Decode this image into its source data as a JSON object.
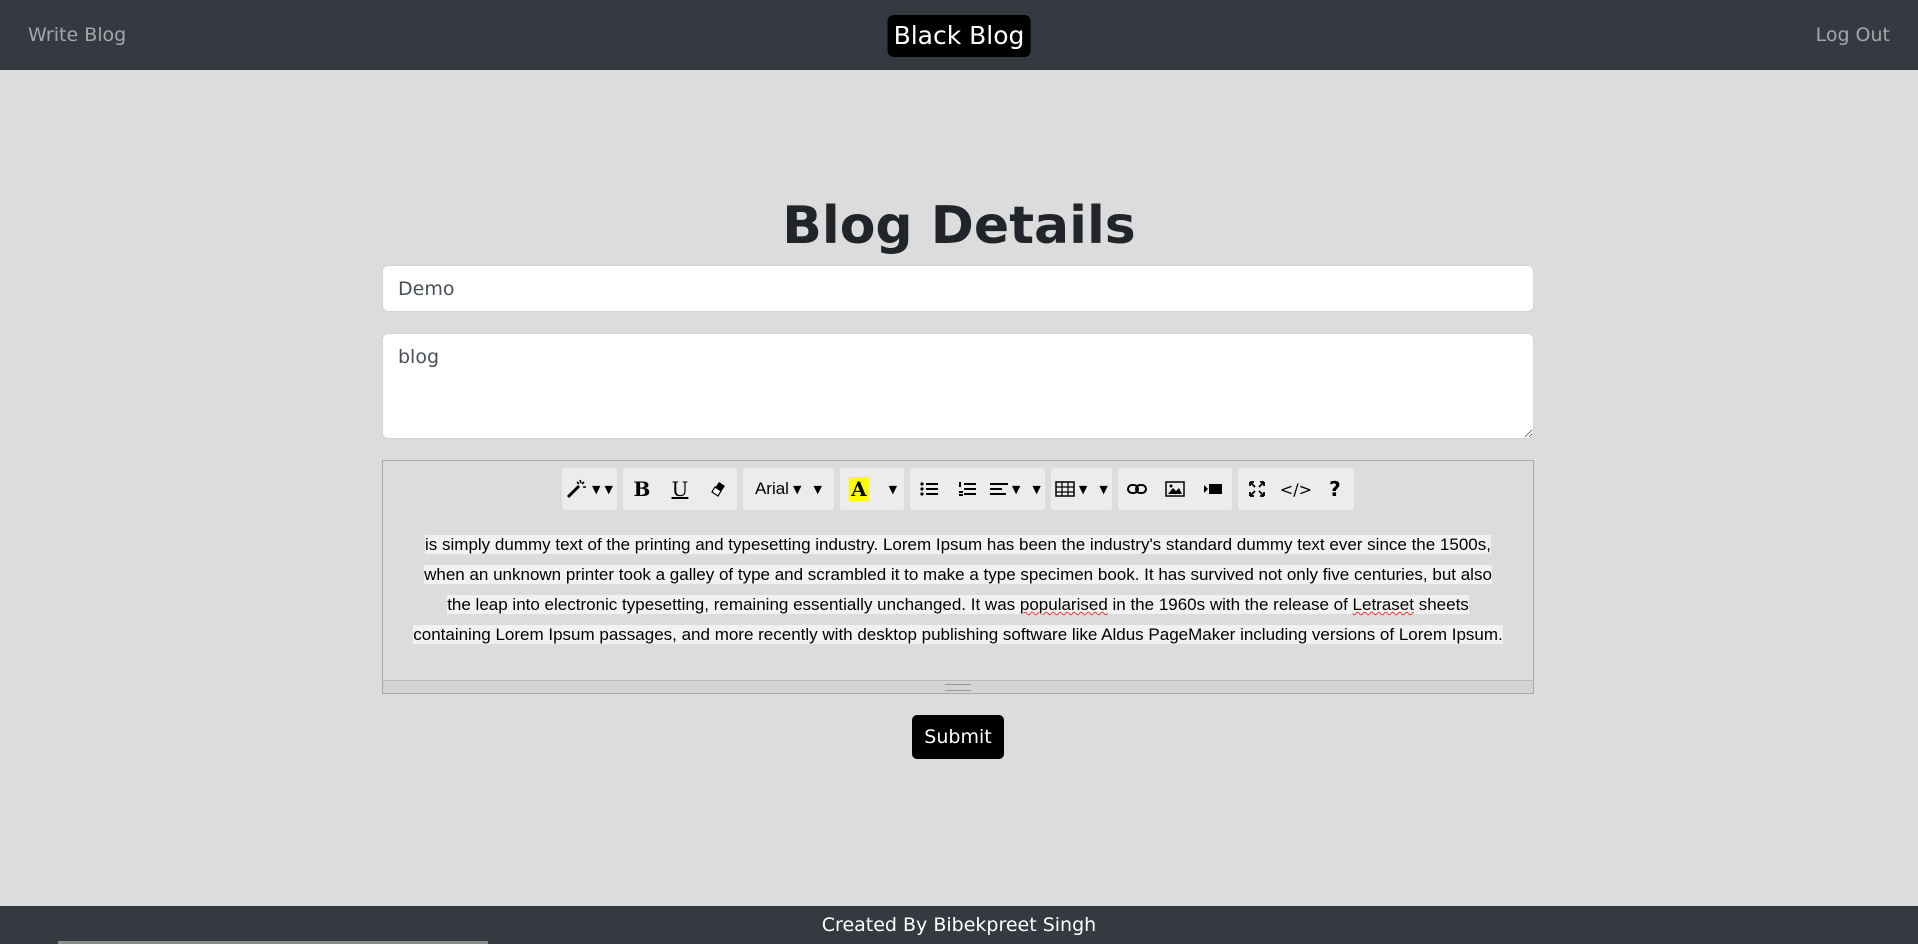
{
  "navbar": {
    "write_blog": "Write Blog",
    "brand": "Black Blog",
    "logout": "Log Out"
  },
  "main": {
    "title": "Blog Details",
    "title_input_value": "Demo",
    "description_value": "blog"
  },
  "editor": {
    "toolbar": {
      "style": "magic-icon",
      "bold": "B",
      "underline": "U",
      "clear": "eraser-icon",
      "font": "Arial",
      "color_letter": "A",
      "table": "table-icon",
      "link": "link-icon",
      "picture": "picture-icon",
      "video": "video-icon",
      "fullscreen": "fullscreen-icon",
      "codeview": "</>",
      "help": "?"
    },
    "content": {
      "line1": " is simply dummy text of the printing and typesetting industry. Lorem Ipsum has been the industry's standard dummy text ever since the 1500s,",
      "line2": "when an unknown printer took a galley of type and scrambled it to make a type specimen book. It has survived not only five centuries, but also",
      "line3_a": "the leap into electronic typesetting, remaining essentially unchanged. It was ",
      "line3_b": "popularised",
      "line3_c": " in the 1960s with the release of ",
      "line3_d": "Letraset",
      "line3_e": " sheets",
      "line4": "containing Lorem Ipsum passages, and more recently with desktop publishing software like Aldus PageMaker including versions of Lorem Ipsum."
    }
  },
  "submit_label": "Submit",
  "footer": "Created By Bibekpreet Singh"
}
